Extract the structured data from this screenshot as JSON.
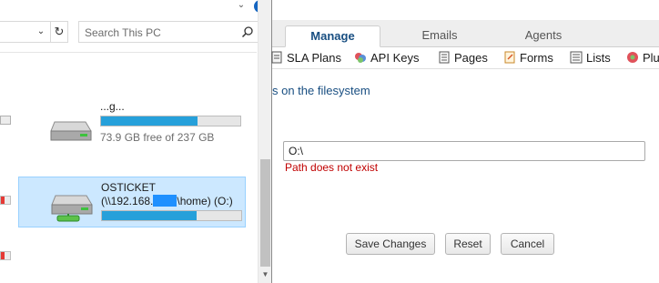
{
  "explorer": {
    "help_label": "?",
    "search": {
      "placeholder": "Search This PC"
    },
    "drives": [
      {
        "name_partial": "...g...",
        "free_text": "73.9 GB free of 237 GB",
        "used_fraction": 0.69
      },
      {
        "name_line1": "OSTICKET",
        "name_line2_prefix": "(\\\\192.168.",
        "name_line2_suffix": "\\home) (O:)",
        "used_fraction": 0.68,
        "selected": true
      }
    ]
  },
  "osticket": {
    "tabs": [
      {
        "label": "Manage",
        "active": true
      },
      {
        "label": "Emails",
        "active": false
      },
      {
        "label": "Agents",
        "active": false
      }
    ],
    "subnav": [
      {
        "label": "SLA Plans",
        "icon": "sla-icon"
      },
      {
        "label": "API Keys",
        "icon": "key-icon"
      },
      {
        "label": "Pages",
        "icon": "page-icon"
      },
      {
        "label": "Forms",
        "icon": "form-icon"
      },
      {
        "label": "Lists",
        "icon": "list-icon"
      },
      {
        "label": "Plu",
        "icon": "plugin-icon"
      }
    ],
    "heading": "s on the filesystem",
    "path_value": "O:\\",
    "path_error": "Path does not exist",
    "buttons": {
      "save": "Save Changes",
      "reset": "Reset",
      "cancel": "Cancel"
    }
  }
}
